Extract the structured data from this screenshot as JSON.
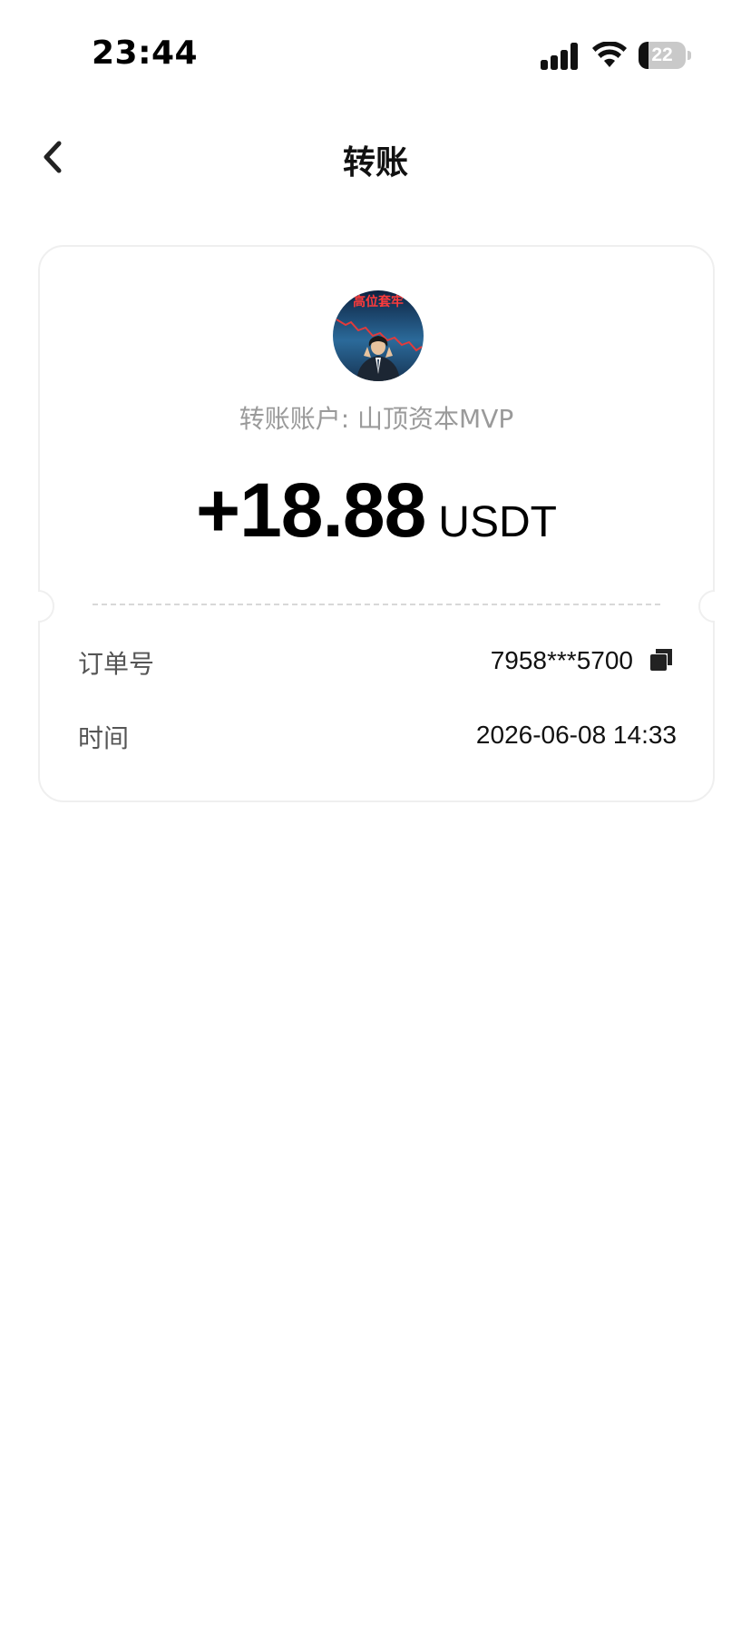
{
  "status_bar": {
    "time": "23:44",
    "battery_level": "22",
    "battery_fraction": 0.22,
    "icons": [
      "signal-icon",
      "wifi-icon",
      "battery-icon"
    ]
  },
  "nav": {
    "title": "转账",
    "back_icon": "chevron-left-icon"
  },
  "transfer": {
    "avatar_caption": "高位套牢",
    "account_label": "转账账户: 山顶资本MVP",
    "amount": "+18.88",
    "currency": "USDT"
  },
  "details": {
    "order_label": "订单号",
    "order_value": "7958***5700",
    "copy_icon": "copy-icon",
    "time_label": "时间",
    "time_value": "2026-06-08 14:33"
  },
  "colors": {
    "background": "#ffffff",
    "card_border": "#efefef",
    "muted_text": "#9a9a9a",
    "label_text": "#555555",
    "primary_text": "#111111"
  }
}
